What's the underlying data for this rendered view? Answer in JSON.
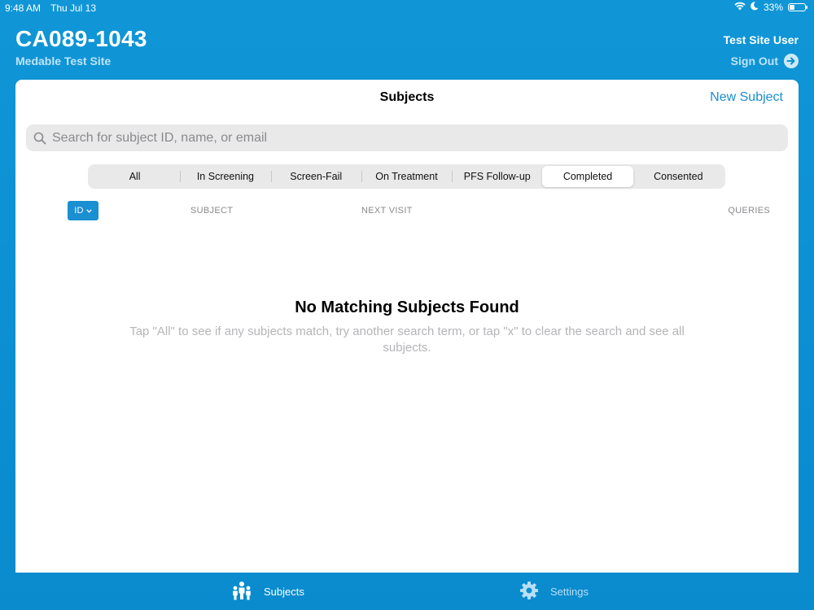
{
  "status_bar": {
    "time": "9:48 AM",
    "date": "Thu Jul 13",
    "battery": "33%",
    "battery_level": 0.33
  },
  "header": {
    "title": "CA089-1043",
    "site": "Medable Test Site",
    "user": "Test Site User",
    "sign_out": "Sign Out"
  },
  "card": {
    "title": "Subjects",
    "new_subject": "New Subject",
    "search_placeholder": "Search for subject ID, name, or email",
    "segments": [
      "All",
      "In Screening",
      "Screen-Fail",
      "On Treatment",
      "PFS Follow-up",
      "Completed",
      "Consented"
    ],
    "active_segment": "Completed",
    "columns": {
      "id": "ID",
      "subject": "SUBJECT",
      "next_visit": "NEXT VISIT",
      "queries": "QUERIES"
    },
    "empty_title": "No Matching Subjects Found",
    "empty_message": "Tap \"All\" to see if any subjects match, try another search term, or tap \"x\" to clear the search and see all subjects."
  },
  "tab_bar": {
    "subjects": "Subjects",
    "settings": "Settings"
  },
  "colors": {
    "background": "#0b8fd2",
    "accent": "#1a8fd1"
  }
}
